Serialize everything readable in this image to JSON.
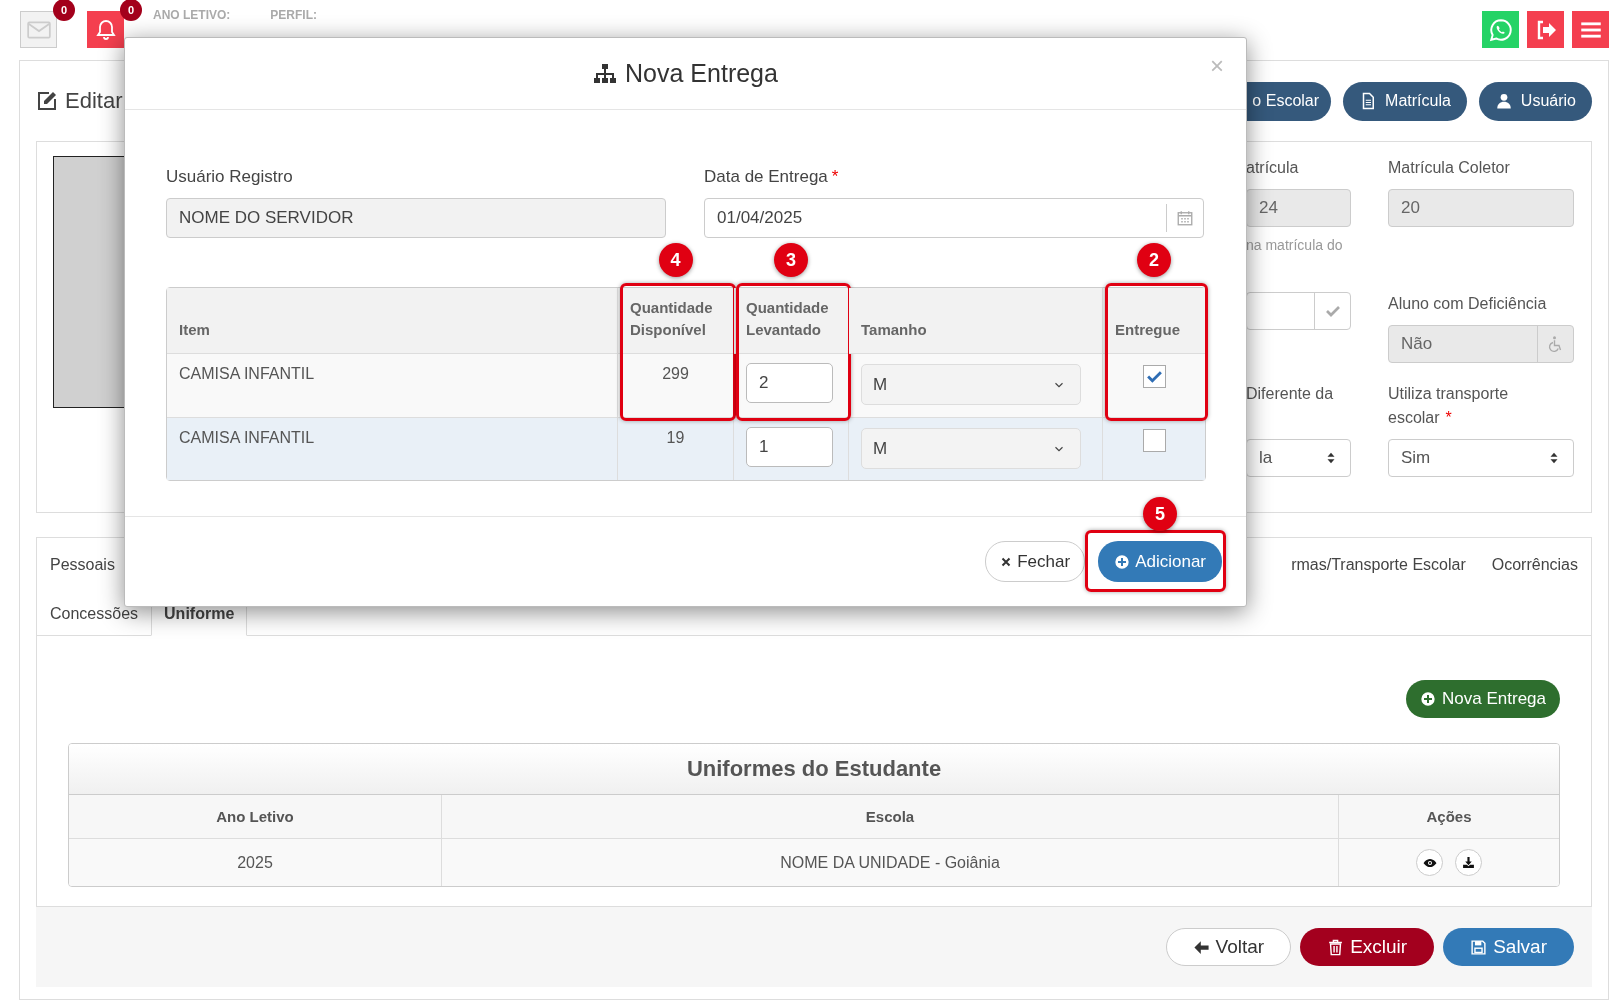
{
  "topbar": {
    "mail_badge": "0",
    "alert_badge": "0",
    "year_label": "ANO LETIVO:",
    "profile_label": "PERFIL:"
  },
  "page": {
    "title": "Editar",
    "header_buttons": [
      "o Escolar",
      "Matrícula",
      "Usuário"
    ]
  },
  "fields": [
    {
      "label": "atrícula",
      "value": "24",
      "helper": "na matrícula do",
      "kind": "text",
      "disabled": true
    },
    {
      "label": "Matrícula Coletor",
      "value": "20",
      "kind": "text",
      "disabled": true
    },
    {
      "kind": "check",
      "disabled": false
    },
    {
      "label": "Aluno com Deficiência",
      "value": "Não",
      "kind": "wheelchair",
      "disabled": true
    },
    {
      "label": "Diferente da",
      "value": "la",
      "kind": "select",
      "disabled": false
    },
    {
      "label": "Utiliza transporte escolar",
      "required_mark": "*",
      "value": "Sim",
      "kind": "select",
      "disabled": false
    }
  ],
  "tab_rows": [
    [
      {
        "label": "Pessoais",
        "selected": false
      },
      {
        "label": "rmas/Transporte Escolar",
        "selected": false
      },
      {
        "label": "Ocorrências",
        "selected": false
      }
    ],
    [
      {
        "label": "Concessões",
        "selected": false
      },
      {
        "label": "Uniforme",
        "selected": true
      }
    ]
  ],
  "new_button": "Nova Entrega",
  "uniform_table": {
    "title": "Uniformes do Estudante",
    "columns": [
      "Ano Letivo",
      "Escola",
      "Ações"
    ],
    "rows": [
      {
        "year": "2025",
        "school": "NOME DA UNIDADE - Goiânia"
      }
    ]
  },
  "footer_buttons": [
    {
      "label": "Voltar",
      "kind": "default"
    },
    {
      "label": "Excluir",
      "kind": "danger"
    },
    {
      "label": "Salvar",
      "kind": "primary"
    }
  ],
  "modal": {
    "title": "Nova Entrega",
    "close": "×",
    "user_label": "Usuário Registro",
    "user_value": "NOME DO SERVIDOR",
    "date_label": "Data de Entrega",
    "date_required_mark": "*",
    "date_value": "01/04/2025",
    "columns": [
      {
        "label": "Item"
      },
      {
        "label": "Quantidade Disponível",
        "annotation": "4"
      },
      {
        "label": "Quantidade Levantado",
        "annotation": "3"
      },
      {
        "label": "Tamanho"
      },
      {
        "label": "Entregue",
        "annotation": "2"
      }
    ],
    "rows": [
      {
        "item": "CAMISA INFANTIL",
        "available": "299",
        "quantity": "2",
        "size": "M",
        "delivered": true,
        "highlighted": false
      },
      {
        "item": "CAMISA INFANTIL",
        "available": "19",
        "quantity": "1",
        "size": "M",
        "delivered": false,
        "highlighted": true
      }
    ],
    "close_button": "Fechar",
    "add_button": {
      "label": "Adicionar",
      "annotation": "5"
    }
  }
}
